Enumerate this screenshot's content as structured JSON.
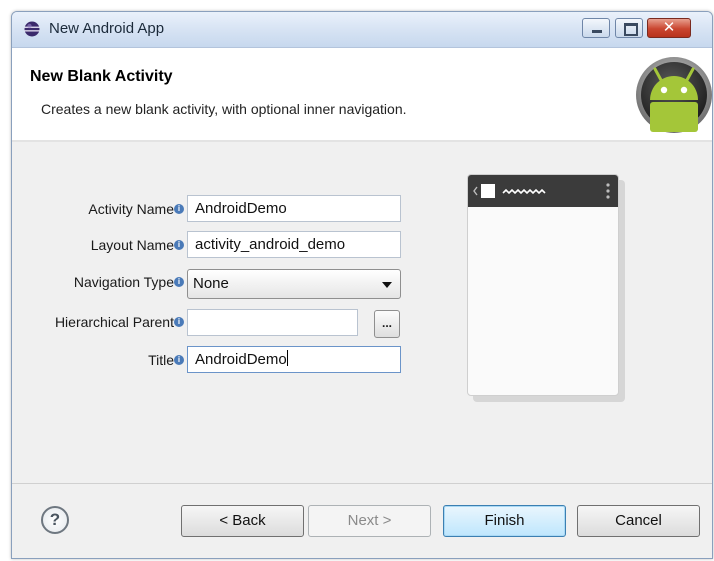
{
  "window": {
    "title": "New Android App",
    "close_symbol": "✕",
    "app_icon": "eclipse-icon"
  },
  "banner": {
    "title": "New Blank Activity",
    "description": "Creates a new blank activity, with optional inner navigation.",
    "logo": "android-robot-icon"
  },
  "form": {
    "activity_name": {
      "label": "Activity Name",
      "value": "AndroidDemo"
    },
    "layout_name": {
      "label": "Layout Name",
      "value": "activity_android_demo"
    },
    "navigation_type": {
      "label": "Navigation Type",
      "value": "None"
    },
    "hierarchical_parent": {
      "label": "Hierarchical Parent",
      "value": "",
      "browse_label": "..."
    },
    "title": {
      "label": "Title",
      "value": "AndroidDemo"
    },
    "info_glyph": "i"
  },
  "footer": {
    "help_label": "?",
    "back_label": "< Back",
    "next_label": "Next >",
    "finish_label": "Finish",
    "cancel_label": "Cancel"
  },
  "colors": {
    "accent": "#3c7fb1",
    "android_green": "#a4c639",
    "preview_bar": "#3b3b3b"
  }
}
